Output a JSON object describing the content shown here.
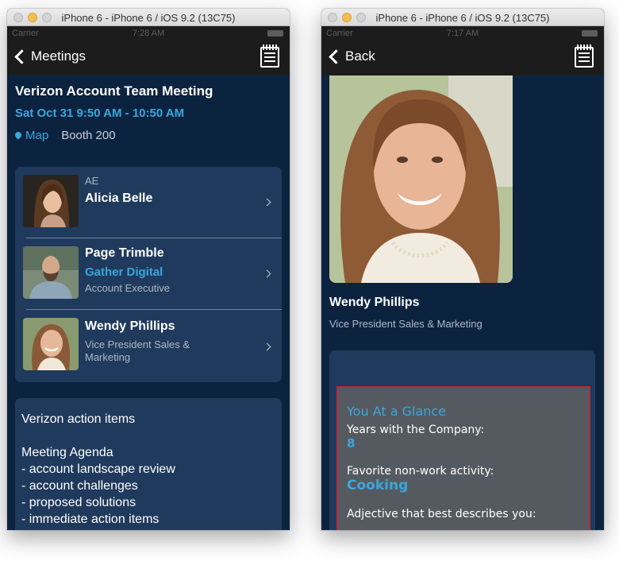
{
  "colors": {
    "accent": "#3aa7dd",
    "background": "#0c2340",
    "card": "#1f3a5c",
    "highlight_border": "#b62a3a"
  },
  "left": {
    "window_title": "iPhone 6 - iPhone 6 / iOS 9.2 (13C75)",
    "status": {
      "carrier": "Carrier",
      "time": "7:28 AM"
    },
    "nav": {
      "back_label": "Meetings",
      "right_icon": "notebook-icon"
    },
    "meeting": {
      "title": "Verizon Account Team Meeting",
      "time": "Sat  Oct 31 9:50 AM - 10:50 AM",
      "map_label": "Map",
      "location": "Booth 200"
    },
    "people": [
      {
        "role_tag": "AE",
        "name": "Alicia Belle"
      },
      {
        "name": "Page Trimble",
        "company": "Gather Digital",
        "title": "Account Executive"
      },
      {
        "name": "Wendy Phillips",
        "title_line1": "Vice President Sales &",
        "title_line2": "Marketing"
      }
    ],
    "notes": {
      "heading": "Verizon action items",
      "agenda_title": "Meeting Agenda",
      "items": [
        "- account landscape review",
        "- account challenges",
        "- proposed solutions",
        "- immediate action items"
      ]
    }
  },
  "right": {
    "window_title": "iPhone 6 - iPhone 6 / iOS 9.2 (13C75)",
    "status": {
      "carrier": "Carrier",
      "time": "7:17 AM"
    },
    "nav": {
      "back_label": "Back",
      "right_icon": "notebook-icon"
    },
    "profile": {
      "name": "Wendy Phillips",
      "title": "Vice President Sales & Marketing"
    },
    "glance": {
      "heading": "You At a Glance",
      "q1_label": "Years with the Company:",
      "q1_value": "8",
      "q2_label": "Favorite non-work activity:",
      "q2_value": "Cooking",
      "q3_label": "Adjective that best describes you:"
    }
  }
}
